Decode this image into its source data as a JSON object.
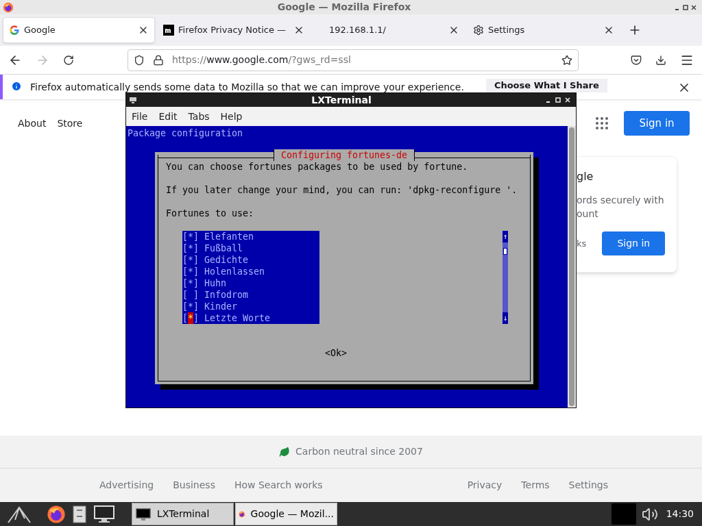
{
  "window": {
    "title": "Google — Mozilla Firefox"
  },
  "tabs": [
    {
      "label": "Google",
      "selected": true,
      "kind": "google"
    },
    {
      "label": "Firefox Privacy Notice —",
      "selected": false,
      "kind": "mozilla"
    },
    {
      "label": "192.168.1.1/",
      "selected": false,
      "kind": "none"
    },
    {
      "label": "Settings",
      "selected": false,
      "kind": "gear"
    }
  ],
  "url": {
    "prefix": "https://",
    "domain": "www.google.com",
    "suffix": "/?gws_rd=ssl"
  },
  "notification": {
    "text": "Firefox automatically sends some data to Mozilla so that we can improve your experience.",
    "button": "Choose What I Share"
  },
  "google": {
    "nav": [
      "About",
      "Store"
    ],
    "sign_in": "Sign in",
    "card": {
      "title": "gle",
      "lines": [
        "ords securely with",
        "ount"
      ],
      "link": "ks",
      "button": "Sign in"
    },
    "carbon": "Carbon neutral since 2007",
    "footer_left": [
      "Advertising",
      "Business",
      "How Search works"
    ],
    "footer_right": [
      "Privacy",
      "Terms",
      "Settings"
    ]
  },
  "terminal": {
    "title": "LXTerminal",
    "menu": [
      "File",
      "Edit",
      "Tabs",
      "Help"
    ],
    "header": "Package configuration",
    "dialog": {
      "title": "Configuring fortunes-de",
      "lines": [
        "You can choose fortunes packages to be used by fortune.",
        "If you later change your mind, you can run: 'dpkg-reconfigure '.",
        "Fortunes to use:"
      ],
      "open": "[",
      "mark": "*",
      "close": "]",
      "items": [
        {
          "label": "Elefanten",
          "checked": true,
          "selected": false
        },
        {
          "label": "Fußball",
          "checked": true,
          "selected": false
        },
        {
          "label": "Gedichte",
          "checked": true,
          "selected": false
        },
        {
          "label": "Holenlassen",
          "checked": true,
          "selected": false
        },
        {
          "label": "Huhn",
          "checked": true,
          "selected": false
        },
        {
          "label": "Infodrom",
          "checked": false,
          "selected": false
        },
        {
          "label": "Kinder",
          "checked": true,
          "selected": false
        },
        {
          "label": "Letzte Worte",
          "checked": true,
          "selected": true
        }
      ],
      "up": "↑",
      "down": "↓",
      "ok": "<Ok>"
    }
  },
  "taskbar": {
    "tasks": [
      {
        "label": "LXTerminal",
        "selected": true,
        "kind": "terminal"
      },
      {
        "label": "Google — Mozil...",
        "selected": false,
        "kind": "firefox"
      }
    ],
    "clock": "14:30"
  }
}
